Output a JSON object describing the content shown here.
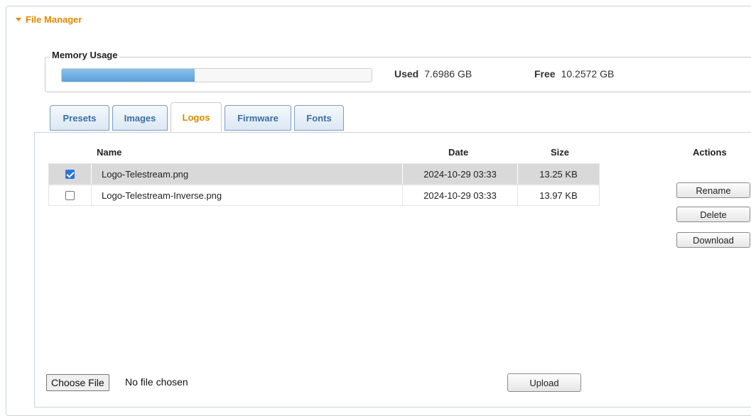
{
  "header": {
    "title": "File Manager"
  },
  "memory": {
    "legend": "Memory Usage",
    "used_label": "Used",
    "used_value": "7.6986 GB",
    "free_label": "Free",
    "free_value": "10.2572 GB",
    "used_fraction": 0.43
  },
  "tabs": [
    {
      "label": "Presets"
    },
    {
      "label": "Images"
    },
    {
      "label": "Logos"
    },
    {
      "label": "Firmware"
    },
    {
      "label": "Fonts"
    }
  ],
  "active_tab": "Logos",
  "table": {
    "headers": {
      "name": "Name",
      "date": "Date",
      "size": "Size",
      "actions": "Actions"
    },
    "rows": [
      {
        "checked": true,
        "name": "Logo-Telestream.png",
        "date": "2024-10-29 03:33",
        "size": "13.25 KB"
      },
      {
        "checked": false,
        "name": "Logo-Telestream-Inverse.png",
        "date": "2024-10-29 03:33",
        "size": "13.97 KB"
      }
    ]
  },
  "actions": {
    "rename": "Rename",
    "delete": "Delete",
    "download": "Download"
  },
  "upload": {
    "choose_label": "Choose File",
    "no_file_text": "No file chosen",
    "upload_label": "Upload"
  },
  "colors": {
    "accent": "#e08a00",
    "tab_text": "#3a6ea5",
    "bar_fill": "#5aa0da",
    "selected_row": "#d9d9d9"
  }
}
